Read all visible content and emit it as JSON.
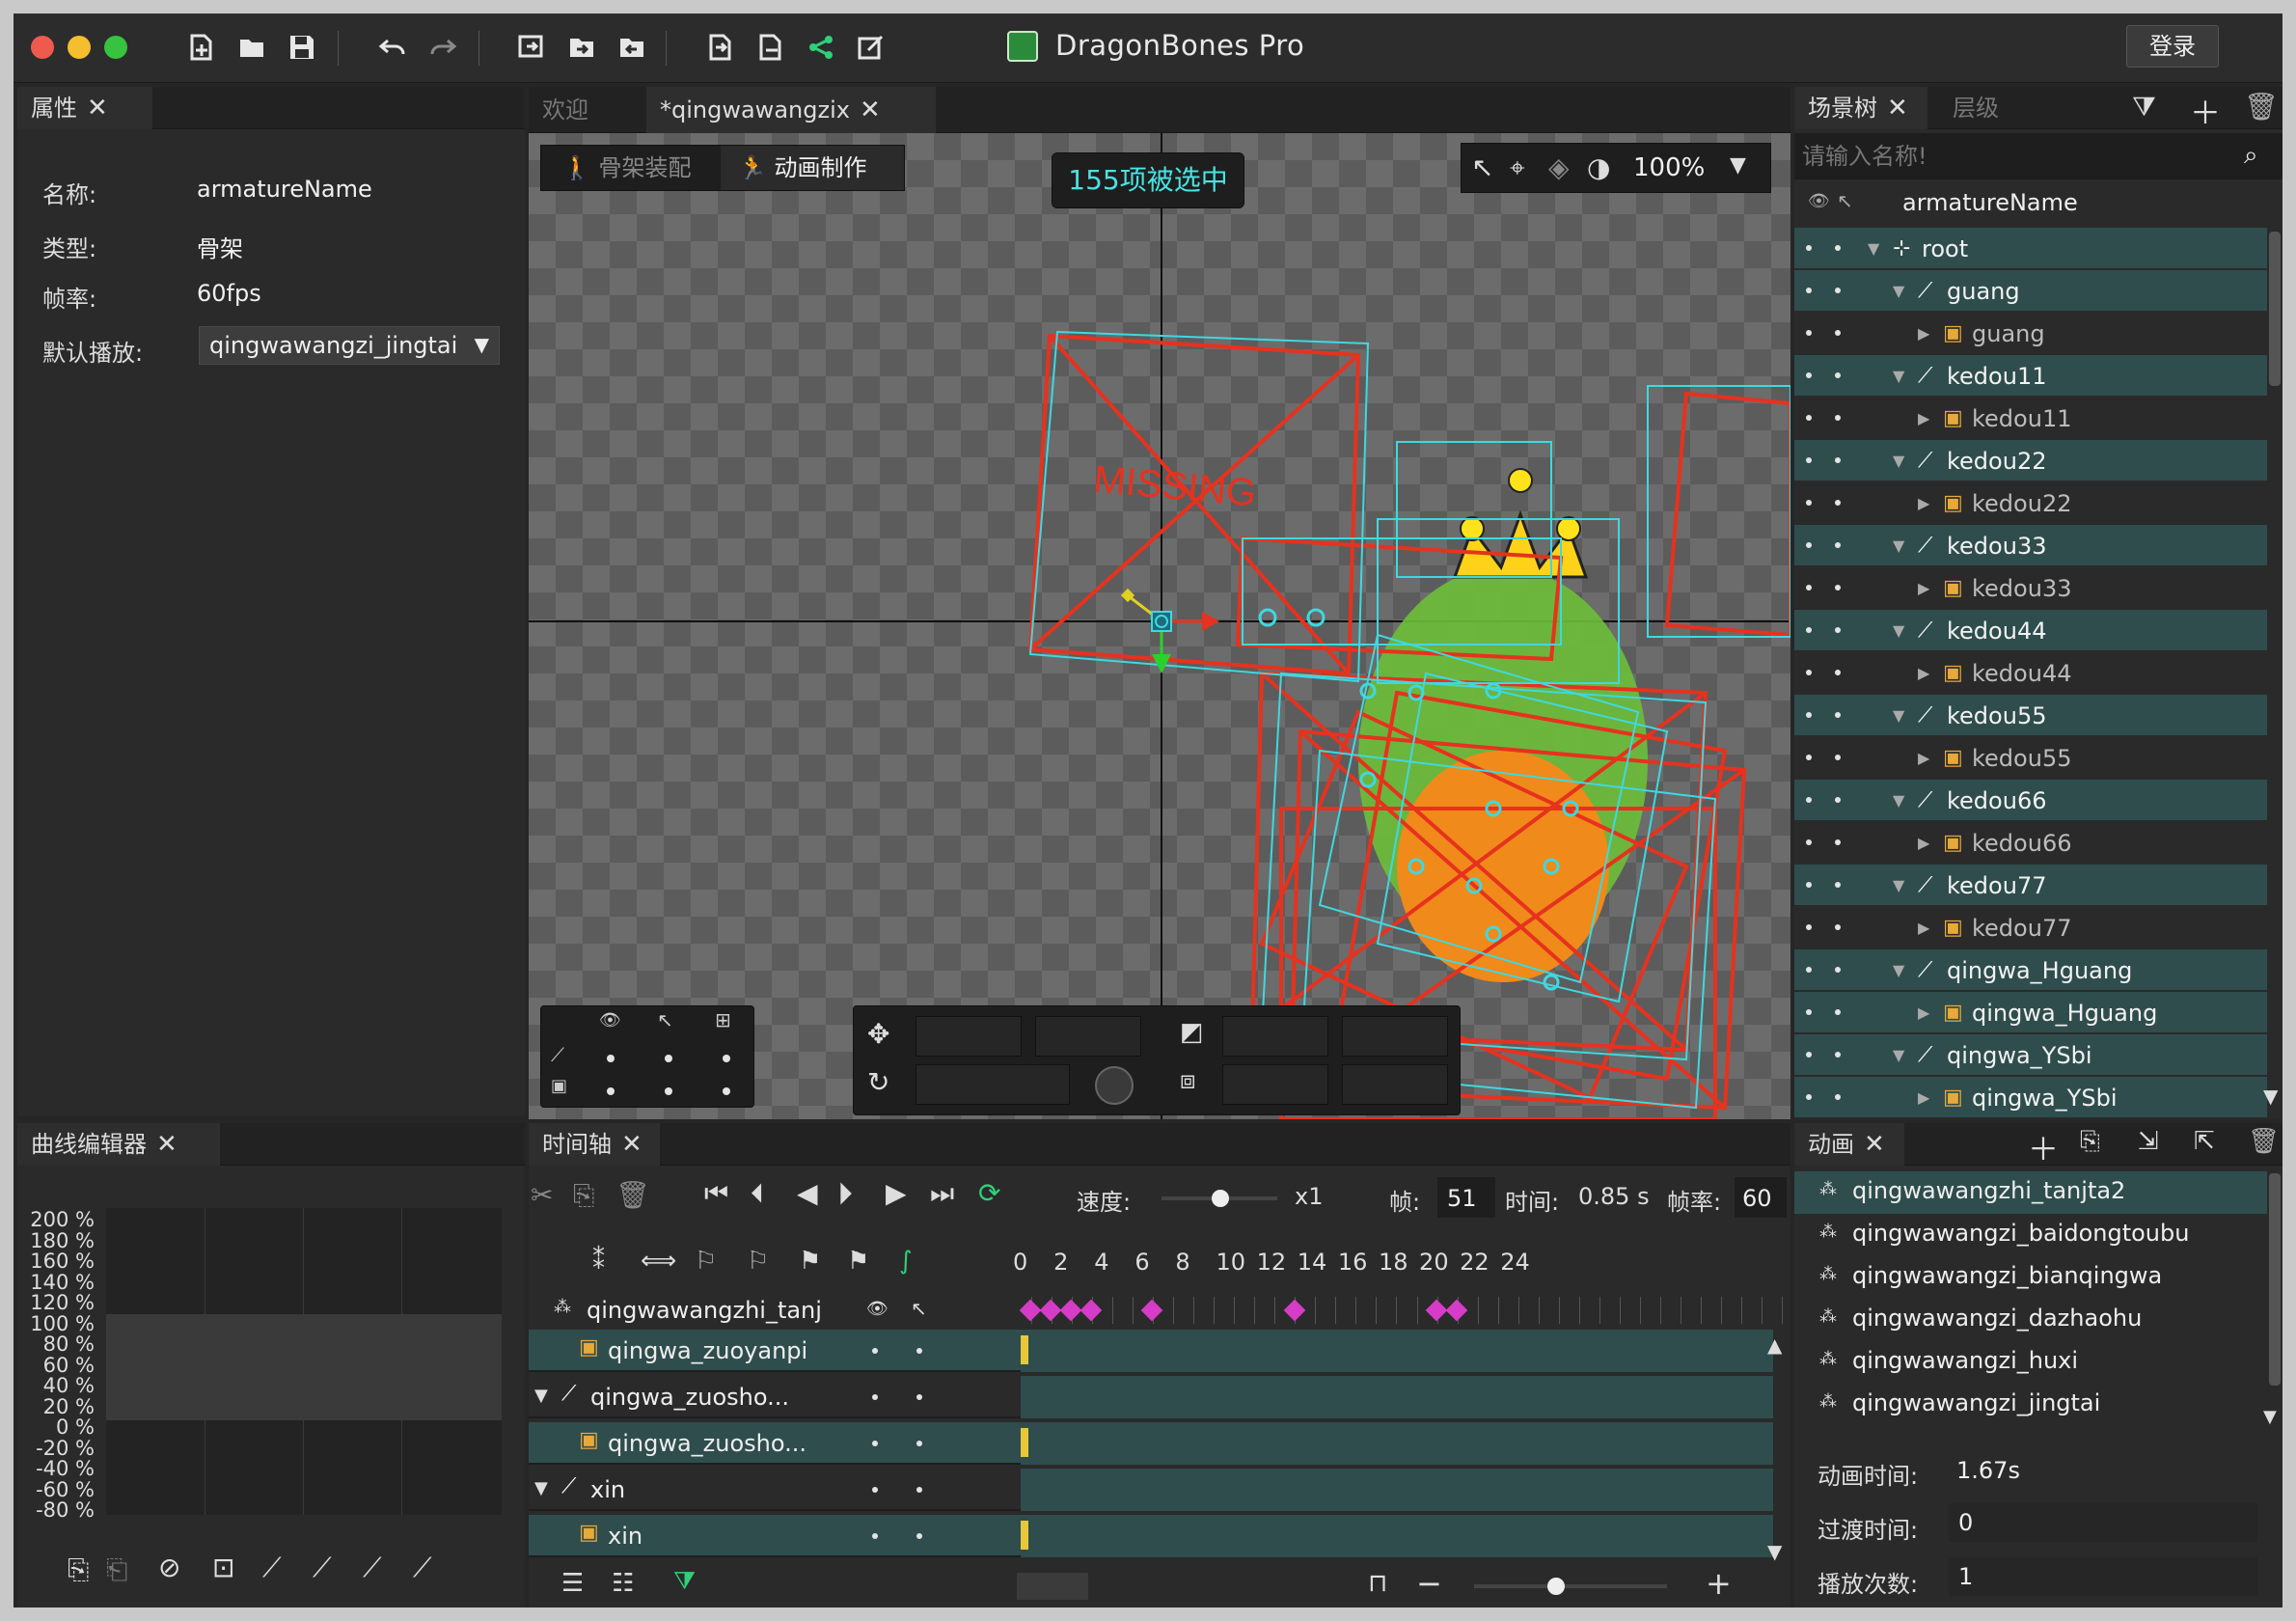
{
  "window": {
    "title": "DragonBones Pro",
    "login_button": "登录",
    "traffic_lights": {
      "close": "#ef5a4f",
      "minimize": "#f5be2e",
      "maximize": "#37c240"
    }
  },
  "properties_panel": {
    "tab_label": "属性",
    "fields": [
      {
        "label": "名称:",
        "value": "armatureName"
      },
      {
        "label": "类型:",
        "value": "骨架"
      },
      {
        "label": "帧率:",
        "value": "60fps"
      }
    ],
    "default_play_label": "默认播放:",
    "default_play_value": "qingwawangzi_jingtai"
  },
  "editor_tabs": [
    {
      "label": "欢迎",
      "active": false
    },
    {
      "label": "*qingwawangzix",
      "active": true
    }
  ],
  "mode_tabs": {
    "rig": "骨架装配",
    "animate": "动画制作"
  },
  "selection_badge": "155项被选中",
  "zoom": "100%",
  "scene_tree": {
    "tab_label": "场景树",
    "tab2_label": "层级",
    "search_placeholder": "请输入名称!",
    "root_name": "armatureName",
    "items": [
      {
        "label": "root",
        "type": "bone",
        "highlight": true,
        "level": 0,
        "arrow": "down"
      },
      {
        "label": "guang",
        "type": "bone",
        "highlight": true,
        "level": 1,
        "arrow": "down"
      },
      {
        "label": "guang",
        "type": "image",
        "highlight": false,
        "level": 2,
        "arrow": "right"
      },
      {
        "label": "kedou11",
        "type": "bone",
        "highlight": true,
        "level": 1,
        "arrow": "down"
      },
      {
        "label": "kedou11",
        "type": "image",
        "highlight": false,
        "level": 2,
        "arrow": "right"
      },
      {
        "label": "kedou22",
        "type": "bone",
        "highlight": true,
        "level": 1,
        "arrow": "down"
      },
      {
        "label": "kedou22",
        "type": "image",
        "highlight": false,
        "level": 2,
        "arrow": "right"
      },
      {
        "label": "kedou33",
        "type": "bone",
        "highlight": true,
        "level": 1,
        "arrow": "down"
      },
      {
        "label": "kedou33",
        "type": "image",
        "highlight": false,
        "level": 2,
        "arrow": "right"
      },
      {
        "label": "kedou44",
        "type": "bone",
        "highlight": true,
        "level": 1,
        "arrow": "down"
      },
      {
        "label": "kedou44",
        "type": "image",
        "highlight": false,
        "level": 2,
        "arrow": "right"
      },
      {
        "label": "kedou55",
        "type": "bone",
        "highlight": true,
        "level": 1,
        "arrow": "down"
      },
      {
        "label": "kedou55",
        "type": "image",
        "highlight": false,
        "level": 2,
        "arrow": "right"
      },
      {
        "label": "kedou66",
        "type": "bone",
        "highlight": true,
        "level": 1,
        "arrow": "down"
      },
      {
        "label": "kedou66",
        "type": "image",
        "highlight": false,
        "level": 2,
        "arrow": "right"
      },
      {
        "label": "kedou77",
        "type": "bone",
        "highlight": true,
        "level": 1,
        "arrow": "down"
      },
      {
        "label": "kedou77",
        "type": "image",
        "highlight": false,
        "level": 2,
        "arrow": "right"
      },
      {
        "label": "qingwa_Hguang",
        "type": "bone",
        "highlight": true,
        "level": 1,
        "arrow": "down"
      },
      {
        "label": "qingwa_Hguang",
        "type": "image",
        "highlight": true,
        "level": 2,
        "arrow": "right"
      },
      {
        "label": "qingwa_YSbi",
        "type": "bone",
        "highlight": true,
        "level": 1,
        "arrow": "down"
      },
      {
        "label": "qingwa_YSbi",
        "type": "image",
        "highlight": true,
        "level": 2,
        "arrow": "right"
      }
    ]
  },
  "curve_editor": {
    "tab_label": "曲线编辑器",
    "y_labels": [
      "200 %",
      "180 %",
      "160 %",
      "140 %",
      "120 %",
      "100 %",
      "80 %",
      "60 %",
      "40 %",
      "20 %",
      "0 %",
      "-20 %",
      "-40 %",
      "-60 %",
      "-80 %"
    ]
  },
  "timeline": {
    "tab_label": "时间轴",
    "speed_label": "速度:",
    "speed_value": "x1",
    "frame_label": "帧:",
    "frame_value": "51",
    "time_label": "时间:",
    "time_value": "0.85 s",
    "fps_label": "帧率:",
    "fps_value": "60",
    "ruler": [
      "0",
      "2",
      "4",
      "6",
      "8",
      "10",
      "12",
      "14",
      "16",
      "18",
      "20",
      "22",
      "24"
    ],
    "animation_track": "qingwawangzhi_tanj",
    "layers": [
      {
        "label": "qingwa_zuoyanpi",
        "type": "image",
        "indent": true,
        "arrow": ""
      },
      {
        "label": "qingwa_zuosho...",
        "type": "bone",
        "indent": false,
        "arrow": "down"
      },
      {
        "label": "qingwa_zuosho...",
        "type": "image",
        "indent": true,
        "arrow": ""
      },
      {
        "label": "xin",
        "type": "bone",
        "indent": false,
        "arrow": "down"
      },
      {
        "label": "xin",
        "type": "image",
        "indent": true,
        "arrow": ""
      }
    ],
    "keyframes": [
      0,
      1,
      2,
      3,
      6,
      13,
      20,
      21
    ]
  },
  "animation_panel": {
    "tab_label": "动画",
    "items": [
      {
        "label": "qingwawangzhi_tanjta2",
        "selected": true
      },
      {
        "label": "qingwawangzi_baidongtoubu",
        "selected": false
      },
      {
        "label": "qingwawangzi_bianqingwa",
        "selected": false
      },
      {
        "label": "qingwawangzi_dazhaohu",
        "selected": false
      },
      {
        "label": "qingwawangzi_huxi",
        "selected": false
      },
      {
        "label": "qingwawangzi_jingtai",
        "selected": false
      }
    ],
    "anim_time_label": "动画时间:",
    "anim_time_value": "1.67s",
    "fade_time_label": "过渡时间:",
    "fade_time_value": "0",
    "play_times_label": "播放次数:",
    "play_times_value": "1"
  }
}
